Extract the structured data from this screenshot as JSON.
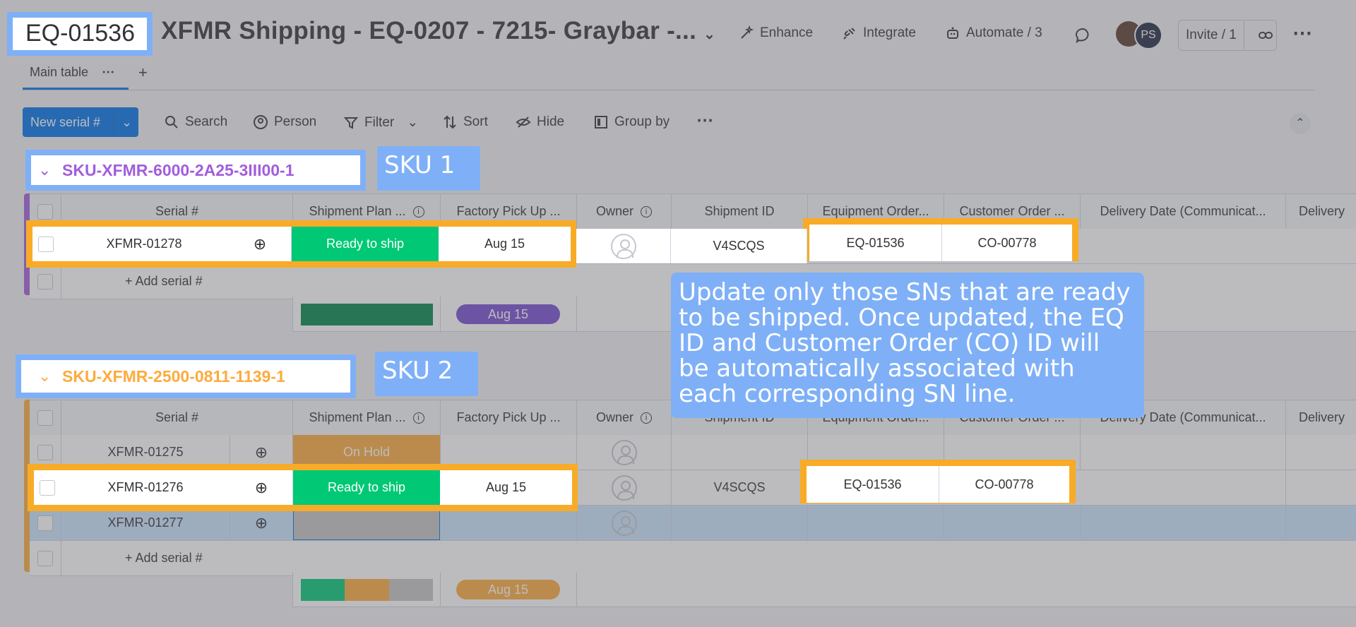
{
  "header": {
    "board_id": "EQ-01536",
    "board_title": "XFMR Shipping - EQ-0207 - 7215- Graybar -...",
    "enhance": "Enhance",
    "integrate": "Integrate",
    "automate": "Automate / 3",
    "avatar_initials": "PS",
    "invite": "Invite / 1"
  },
  "tabs": {
    "main": "Main table",
    "add": "+"
  },
  "toolbar": {
    "new_item": "New serial #",
    "search": "Search",
    "person": "Person",
    "filter": "Filter",
    "sort": "Sort",
    "hide": "Hide",
    "group_by": "Group by"
  },
  "columns": [
    "Serial #",
    "Shipment Plan ...",
    "Factory Pick Up ...",
    "Owner",
    "Shipment ID",
    "Equipment Order...",
    "Customer Order ...",
    "Delivery Date (Communicat...",
    "Delivery"
  ],
  "group1": {
    "name": "SKU-XFMR-6000-2A25-3III00-1",
    "tag": "SKU 1",
    "color": "#a25ddc",
    "rows": [
      {
        "serial": "XFMR-01278",
        "status": "Ready to ship",
        "pickup": "Aug 15",
        "shipment_id": "V4SCQS",
        "eq": "EQ-01536",
        "co": "CO-00778"
      }
    ],
    "add_label": "+ Add serial #",
    "summary_date": "Aug 15"
  },
  "group2": {
    "name": "SKU-XFMR-2500-0811-1139-1",
    "tag": "SKU 2",
    "color": "#fdab3d",
    "rows": [
      {
        "serial": "XFMR-01275",
        "status": "On Hold",
        "pickup": "",
        "shipment_id": "",
        "eq": "",
        "co": ""
      },
      {
        "serial": "XFMR-01276",
        "status": "Ready to ship",
        "pickup": "Aug 15",
        "shipment_id": "V4SCQS",
        "eq": "EQ-01536",
        "co": "CO-00778"
      },
      {
        "serial": "XFMR-01277",
        "status": "",
        "pickup": "",
        "shipment_id": "",
        "eq": "",
        "co": ""
      }
    ],
    "add_label": "+ Add serial #",
    "summary_date": "Aug 15"
  },
  "annotation": {
    "note": "Update only those SNs that are ready to be shipped. Once updated, the EQ ID and Customer Order (CO) ID will be automatically associated with each corresponding SN line."
  },
  "colors": {
    "ready": "#00c875",
    "hold": "#fdab3d",
    "blank": "#c4c4c4",
    "accent": "#0073ea",
    "highlight": "#f8ab27",
    "callout": "#7fb0f7"
  }
}
